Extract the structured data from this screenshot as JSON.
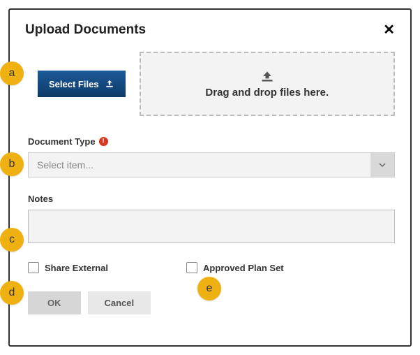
{
  "modal": {
    "title": "Upload Documents",
    "close_aria": "Close"
  },
  "upload": {
    "select_files_label": "Select Files",
    "dropzone_text": "Drag and drop files here."
  },
  "doc_type": {
    "label": "Document Type",
    "placeholder": "Select item..."
  },
  "notes": {
    "label": "Notes",
    "value": ""
  },
  "checkboxes": {
    "share_external_label": "Share External",
    "approved_plan_set_label": "Approved Plan Set"
  },
  "buttons": {
    "ok": "OK",
    "cancel": "Cancel"
  },
  "badges": {
    "a": "a",
    "b": "b",
    "c": "c",
    "d": "d",
    "e": "e"
  }
}
